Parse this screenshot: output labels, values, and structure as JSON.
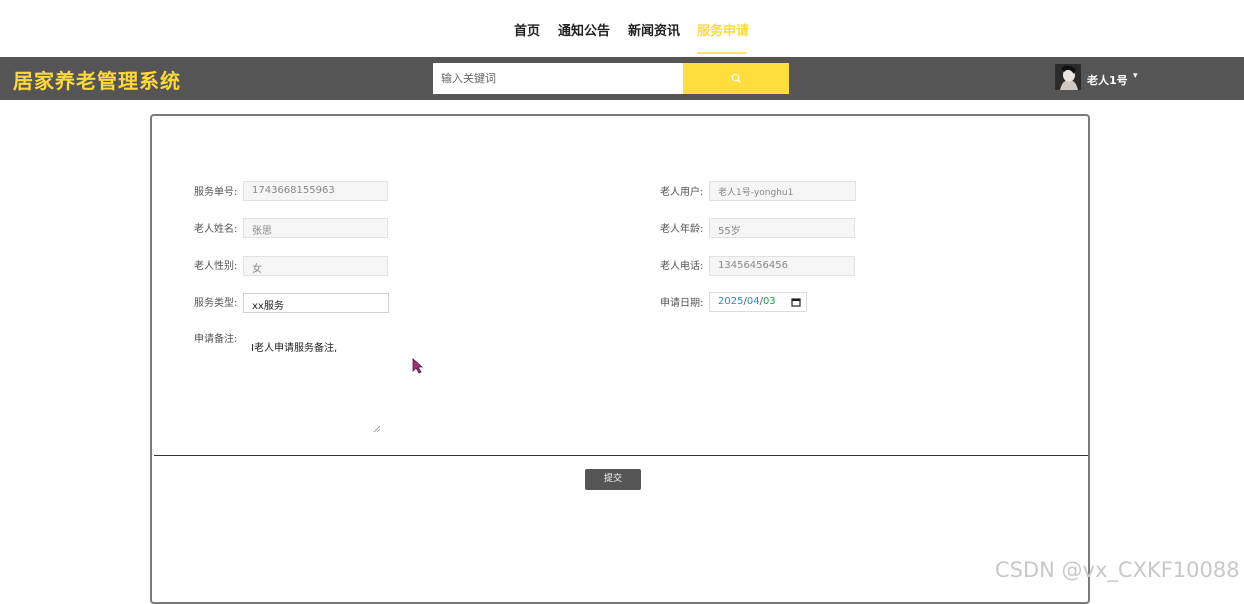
{
  "nav": {
    "items": [
      {
        "label": "首页"
      },
      {
        "label": "通知公告"
      },
      {
        "label": "新闻资讯"
      },
      {
        "label": "服务申请"
      }
    ],
    "active": "服务申请"
  },
  "header": {
    "title": "居家养老管理系统",
    "search_placeholder": "输入关键词",
    "search_icon": "search-icon",
    "user_name": "老人1号",
    "caret": "▾"
  },
  "form": {
    "service_no": {
      "label": "服务单号:",
      "value": "1743668155963"
    },
    "elder_user": {
      "label": "老人用户:",
      "value": "老人1号-yonghu1"
    },
    "elder_name": {
      "label": "老人姓名:",
      "value": "张思"
    },
    "elder_age": {
      "label": "老人年龄:",
      "value": "55岁"
    },
    "elder_gender": {
      "label": "老人性别:",
      "value": "女"
    },
    "elder_phone": {
      "label": "老人电话:",
      "value": "13456456456"
    },
    "service_type": {
      "label": "服务类型:",
      "value": "xx服务"
    },
    "apply_date": {
      "label": "申请日期:",
      "year": "2025",
      "month": "04",
      "day": "03",
      "sep": "/"
    },
    "remark": {
      "label": "申请备注:",
      "value": "I老人申请服务备注,"
    },
    "submit_label": "提交"
  },
  "watermark": "CSDN @vx_CXKF10088",
  "colors": {
    "accent": "#ffd93a",
    "header_bg": "#555555"
  }
}
